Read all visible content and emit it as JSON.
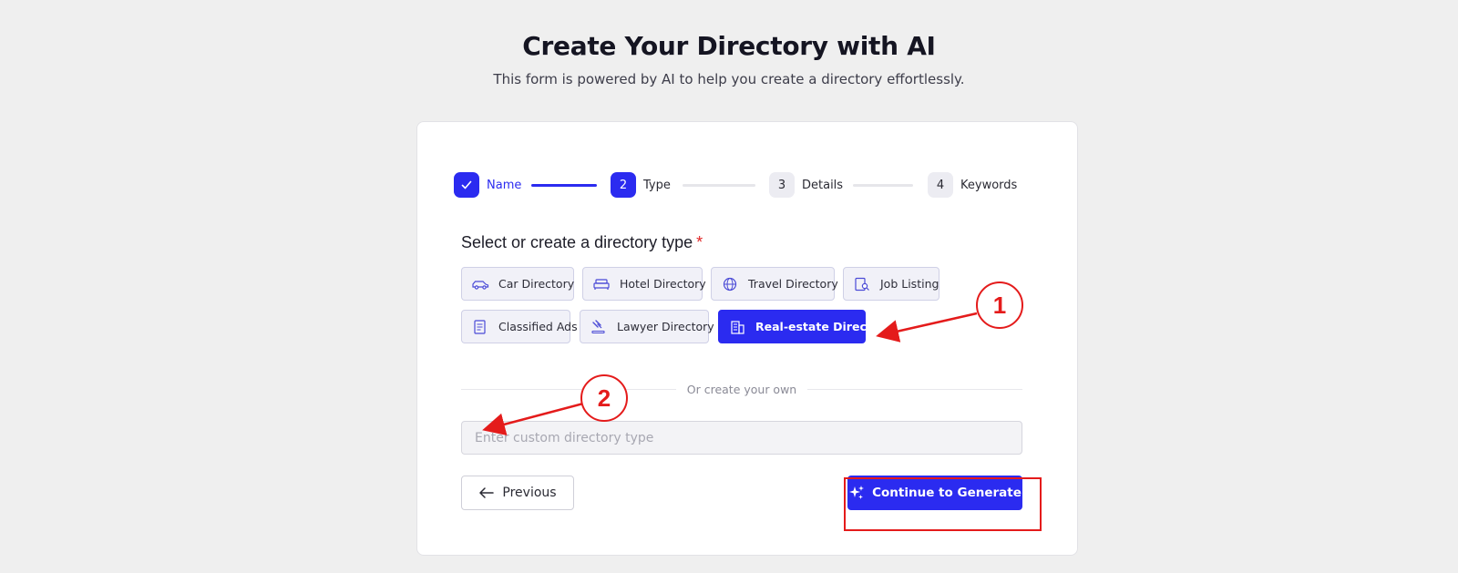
{
  "header": {
    "title": "Create Your Directory with AI",
    "subtitle": "This form is powered by AI to help you create a directory effortlessly."
  },
  "stepper": {
    "steps": [
      {
        "number": "✓",
        "label": "Name",
        "state": "done"
      },
      {
        "number": "2",
        "label": "Type",
        "state": "active"
      },
      {
        "number": "3",
        "label": "Details",
        "state": "todo"
      },
      {
        "number": "4",
        "label": "Keywords",
        "state": "todo"
      }
    ]
  },
  "form": {
    "section_label": "Select or create a directory type",
    "required_mark": "*",
    "types": [
      {
        "label": "Car Directory",
        "icon": "car-icon"
      },
      {
        "label": "Hotel Directory",
        "icon": "bed-icon"
      },
      {
        "label": "Travel Directory",
        "icon": "globe-icon"
      },
      {
        "label": "Job Listing",
        "icon": "job-search-icon"
      },
      {
        "label": "Classified Ads",
        "icon": "document-icon"
      },
      {
        "label": "Lawyer Directory",
        "icon": "gavel-icon"
      },
      {
        "label": "Real-estate Directory",
        "icon": "building-icon",
        "selected": true
      }
    ],
    "divider_text": "Or create your own",
    "custom_input": {
      "placeholder": "Enter custom directory type",
      "value": ""
    }
  },
  "actions": {
    "previous_label": "Previous",
    "generate_label": "Continue to Generate"
  },
  "annotations": {
    "callout_1": "1",
    "callout_2": "2"
  },
  "colors": {
    "accent": "#2b2bf0",
    "annotation": "#e41b1b",
    "background": "#efefef"
  }
}
